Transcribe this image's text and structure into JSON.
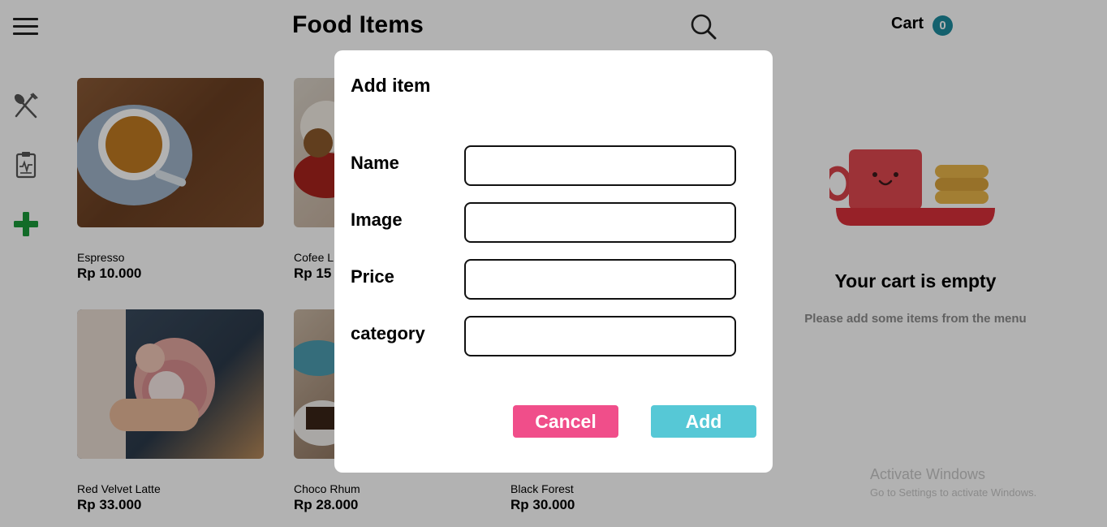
{
  "header": {
    "title": "Food Items",
    "cart_label": "Cart",
    "cart_count": "0"
  },
  "sidebar": {
    "icons": [
      "utensils-icon",
      "clipboard-icon",
      "plus-icon"
    ]
  },
  "items": [
    {
      "name": "Espresso",
      "price": "Rp 10.000"
    },
    {
      "name": "Cofee L",
      "price": "Rp 15"
    },
    {
      "name": "Red Velvet Latte",
      "price": "Rp 33.000"
    },
    {
      "name": "Choco Rhum",
      "price": "Rp 28.000"
    },
    {
      "name": "Black Forest",
      "price": "Rp 30.000"
    }
  ],
  "cart": {
    "empty_title": "Your cart is empty",
    "empty_subtitle": "Please add some items from the menu"
  },
  "modal": {
    "title": "Add item",
    "fields": [
      {
        "label": "Name",
        "value": ""
      },
      {
        "label": "Image",
        "value": ""
      },
      {
        "label": "Price",
        "value": ""
      },
      {
        "label": "category",
        "value": ""
      }
    ],
    "cancel_label": "Cancel",
    "add_label": "Add"
  },
  "watermark": {
    "line1": "Activate Windows",
    "line2": "Go to Settings to activate Windows."
  },
  "colors": {
    "cancel": "#f04e8a",
    "add": "#56c8d6",
    "plus_icon": "#1a9a3a",
    "cart_badge": "#1e8c9e"
  }
}
